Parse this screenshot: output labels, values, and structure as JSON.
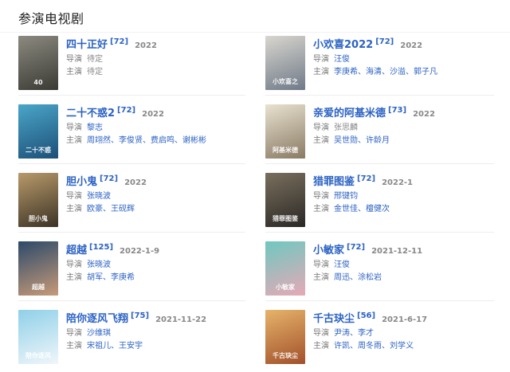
{
  "section": {
    "title": "参演电视剧"
  },
  "colors": {
    "link": "#2b62c4",
    "muted": "#888888",
    "divider": "#ededed"
  },
  "works": [
    {
      "title": "四十正好",
      "score": "[72]",
      "year": "2022",
      "director_label": "导演",
      "directors": [
        "待定"
      ],
      "directors_linked": false,
      "cast_label": "主演",
      "cast": [
        "待定"
      ],
      "cast_linked": false,
      "poster_text": "40",
      "poster_colors": [
        "#8c8a80",
        "#3a3a34"
      ]
    },
    {
      "title": "小欢喜2022",
      "score": "[72]",
      "year": "2022",
      "director_label": "导演",
      "directors": [
        "汪俊"
      ],
      "directors_linked": true,
      "cast_label": "主演",
      "cast": [
        "李庚希",
        "海清",
        "沙溢",
        "郭子凡"
      ],
      "cast_linked": true,
      "poster_text": "小欢喜之",
      "poster_colors": [
        "#d9d6cf",
        "#6f7a88"
      ]
    },
    {
      "title": "二十不惑2",
      "score": "[72]",
      "year": "2022",
      "director_label": "导演",
      "directors": [
        "黎志"
      ],
      "directors_linked": true,
      "cast_label": "主演",
      "cast": [
        "周翊然",
        "李俊贤",
        "费启鸣",
        "谢彬彬"
      ],
      "cast_linked": true,
      "poster_text": "二十不惑",
      "poster_colors": [
        "#4aa6c8",
        "#1d4f78"
      ]
    },
    {
      "title": "亲爱的阿基米德",
      "score": "[73]",
      "year": "2022",
      "director_label": "导演",
      "directors": [
        "张思麟"
      ],
      "directors_linked": false,
      "cast_label": "主演",
      "cast": [
        "吴世勋",
        "许龄月"
      ],
      "cast_linked": true,
      "poster_text": "阿基米德",
      "poster_colors": [
        "#e8e2d0",
        "#8a7a64"
      ]
    },
    {
      "title": "胆小鬼",
      "score": "[72]",
      "year": "2022",
      "director_label": "导演",
      "directors": [
        "张晓波"
      ],
      "directors_linked": true,
      "cast_label": "主演",
      "cast": [
        "欧豪",
        "王砚辉"
      ],
      "cast_linked": true,
      "poster_text": "胆小鬼",
      "poster_colors": [
        "#b89a6a",
        "#3c3326"
      ]
    },
    {
      "title": "猎罪图鉴",
      "score": "[72]",
      "year": "2022-1",
      "director_label": "导演",
      "directors": [
        "邢键钧"
      ],
      "directors_linked": true,
      "cast_label": "主演",
      "cast": [
        "金世佳",
        "檀健次"
      ],
      "cast_linked": true,
      "poster_text": "猎罪图鉴",
      "poster_colors": [
        "#7a6f5e",
        "#2a2824"
      ]
    },
    {
      "title": "超越",
      "score": "[125]",
      "year": "2022-1-9",
      "director_label": "导演",
      "directors": [
        "张晓波"
      ],
      "directors_linked": true,
      "cast_label": "主演",
      "cast": [
        "胡军",
        "李庚希"
      ],
      "cast_linked": true,
      "poster_text": "超越",
      "poster_colors": [
        "#2c4a6a",
        "#c79a78"
      ]
    },
    {
      "title": "小敏家",
      "score": "[72]",
      "year": "2021-12-11",
      "director_label": "导演",
      "directors": [
        "汪俊"
      ],
      "directors_linked": true,
      "cast_label": "主演",
      "cast": [
        "周迅",
        "涂松岩"
      ],
      "cast_linked": true,
      "poster_text": "小敏家",
      "poster_colors": [
        "#6fc8c0",
        "#e6a9b6"
      ]
    },
    {
      "title": "陪你逐风飞翔",
      "score": "[75]",
      "year": "2021-11-22",
      "director_label": "导演",
      "directors": [
        "沙维琪"
      ],
      "directors_linked": true,
      "cast_label": "主演",
      "cast": [
        "宋祖儿",
        "王安宇"
      ],
      "cast_linked": true,
      "poster_text": "陪你逐风",
      "poster_colors": [
        "#8fd0e8",
        "#f0f6fa"
      ]
    },
    {
      "title": "千古玦尘",
      "score": "[56]",
      "year": "2021-6-17",
      "director_label": "导演",
      "directors": [
        "尹涛",
        "李才"
      ],
      "directors_linked": true,
      "cast_label": "主演",
      "cast": [
        "许凯",
        "周冬雨",
        "刘学义"
      ],
      "cast_linked": true,
      "poster_text": "千古玦尘",
      "poster_colors": [
        "#e6b46a",
        "#a2502a"
      ]
    }
  ]
}
